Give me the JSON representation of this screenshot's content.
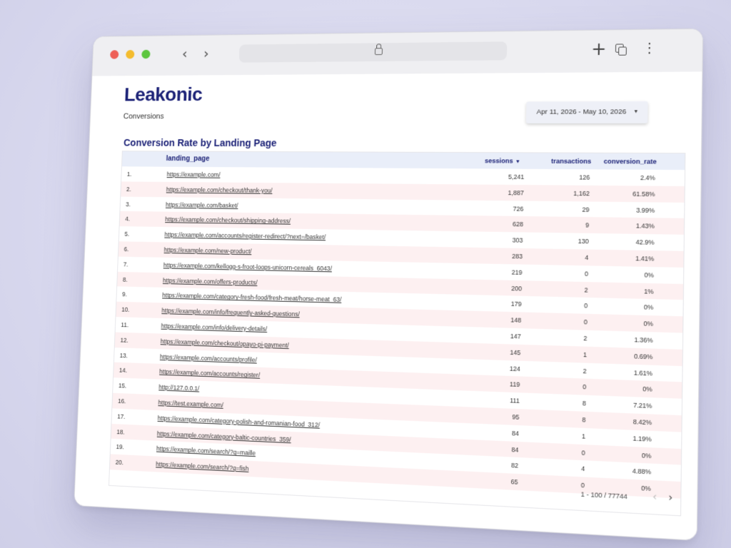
{
  "app": {
    "brand": "Leakonic",
    "subtitle": "Conversions"
  },
  "date_range": {
    "label": "Apr 11, 2026 - May 10, 2026"
  },
  "table": {
    "title": "Conversion Rate by Landing Page",
    "headers": {
      "page": "landing_page",
      "sessions": "sessions",
      "transactions": "transactions",
      "conversion_rate": "conversion_rate"
    },
    "sort_indicator": "▼",
    "rows": [
      {
        "idx": "1.",
        "page": "https://example.com/",
        "sessions": "5,241",
        "transactions": "126",
        "rate": "2.4%"
      },
      {
        "idx": "2.",
        "page": "https://example.com/checkout/thank-you/",
        "sessions": "1,887",
        "transactions": "1,162",
        "rate": "61.58%"
      },
      {
        "idx": "3.",
        "page": "https://example.com/basket/",
        "sessions": "726",
        "transactions": "29",
        "rate": "3.99%"
      },
      {
        "idx": "4.",
        "page": "https://example.com/checkout/shipping-address/",
        "sessions": "628",
        "transactions": "9",
        "rate": "1.43%"
      },
      {
        "idx": "5.",
        "page": "https://example.com/accounts/register-redirect/?next=/basket/",
        "sessions": "303",
        "transactions": "130",
        "rate": "42.9%"
      },
      {
        "idx": "6.",
        "page": "https://example.com/new-product/",
        "sessions": "283",
        "transactions": "4",
        "rate": "1.41%"
      },
      {
        "idx": "7.",
        "page": "https://example.com/kellogg-s-froot-loops-unicorn-cereals_6043/",
        "sessions": "219",
        "transactions": "0",
        "rate": "0%"
      },
      {
        "idx": "8.",
        "page": "https://example.com/offers-products/",
        "sessions": "200",
        "transactions": "2",
        "rate": "1%"
      },
      {
        "idx": "9.",
        "page": "https://example.com/category-fresh-food/fresh-meat/horse-meat_63/",
        "sessions": "179",
        "transactions": "0",
        "rate": "0%"
      },
      {
        "idx": "10.",
        "page": "https://example.com/info/frequently-asked-questions/",
        "sessions": "148",
        "transactions": "0",
        "rate": "0%"
      },
      {
        "idx": "11.",
        "page": "https://example.com/info/delivery-details/",
        "sessions": "147",
        "transactions": "2",
        "rate": "1.36%"
      },
      {
        "idx": "12.",
        "page": "https://example.com/checkout/opayo-pi-payment/",
        "sessions": "145",
        "transactions": "1",
        "rate": "0.69%"
      },
      {
        "idx": "13.",
        "page": "https://example.com/accounts/profile/",
        "sessions": "124",
        "transactions": "2",
        "rate": "1.61%"
      },
      {
        "idx": "14.",
        "page": "https://example.com/accounts/register/",
        "sessions": "119",
        "transactions": "0",
        "rate": "0%"
      },
      {
        "idx": "15.",
        "page": "http://127.0.0.1/",
        "sessions": "111",
        "transactions": "8",
        "rate": "7.21%"
      },
      {
        "idx": "16.",
        "page": "https://test.example.com/",
        "sessions": "95",
        "transactions": "8",
        "rate": "8.42%"
      },
      {
        "idx": "17.",
        "page": "https://example.com/category-polish-and-romanian-food_312/",
        "sessions": "84",
        "transactions": "1",
        "rate": "1.19%"
      },
      {
        "idx": "18.",
        "page": "https://example.com/category-baltic-countries_359/",
        "sessions": "84",
        "transactions": "0",
        "rate": "0%"
      },
      {
        "idx": "19.",
        "page": "https://example.com/search/?q=maille",
        "sessions": "82",
        "transactions": "4",
        "rate": "4.88%"
      },
      {
        "idx": "20.",
        "page": "https://example.com/search/?q=fish",
        "sessions": "65",
        "transactions": "0",
        "rate": "0%"
      }
    ],
    "pagination": {
      "range": "1 - 100 / 77744",
      "prev": "‹",
      "next": "›"
    }
  },
  "icons": {
    "back": "‹",
    "forward": "›",
    "plus": "+",
    "kebab": "⋮"
  }
}
